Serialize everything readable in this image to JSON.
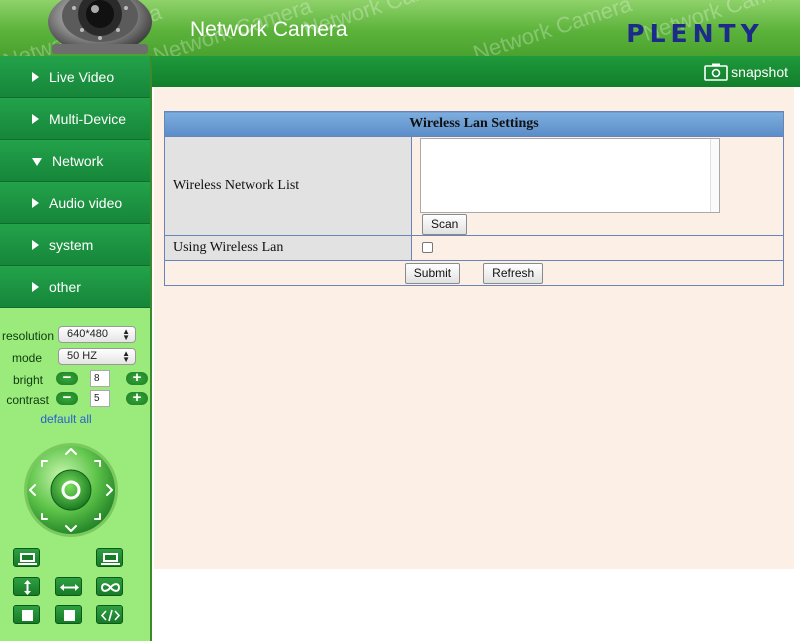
{
  "header": {
    "title": "Network Camera",
    "brand": "PLENTY",
    "watermark": "Network Camera"
  },
  "topbar": {
    "snapshot_label": "snapshot"
  },
  "nav": {
    "items": [
      {
        "label": "Live Video",
        "arrow": "right"
      },
      {
        "label": "Multi-Device",
        "arrow": "right"
      },
      {
        "label": "Network",
        "arrow": "down"
      },
      {
        "label": "Audio video",
        "arrow": "right"
      },
      {
        "label": "system",
        "arrow": "right"
      },
      {
        "label": "other",
        "arrow": "right"
      }
    ]
  },
  "controls": {
    "resolution_label": "resolution",
    "resolution_value": "640*480",
    "mode_label": "mode",
    "mode_value": "50 HZ",
    "bright_label": "bright",
    "bright_value": "8",
    "contrast_label": "contrast",
    "contrast_value": "5",
    "default_all": "default all"
  },
  "settings": {
    "title": "Wireless Lan Settings",
    "network_list_label": "Wireless Network List",
    "scan_button": "Scan",
    "using_wireless_label": "Using Wireless Lan",
    "using_wireless_checked": false,
    "submit_button": "Submit",
    "refresh_button": "Refresh"
  },
  "colors": {
    "nav_bg": "#1e9a44",
    "sidebar_bg": "#9bea7c",
    "header_green": "#5cb33b",
    "table_title_bg": "#6f9fd6",
    "main_bg": "#fbefe6",
    "brand_navy": "#1c2a8a"
  }
}
